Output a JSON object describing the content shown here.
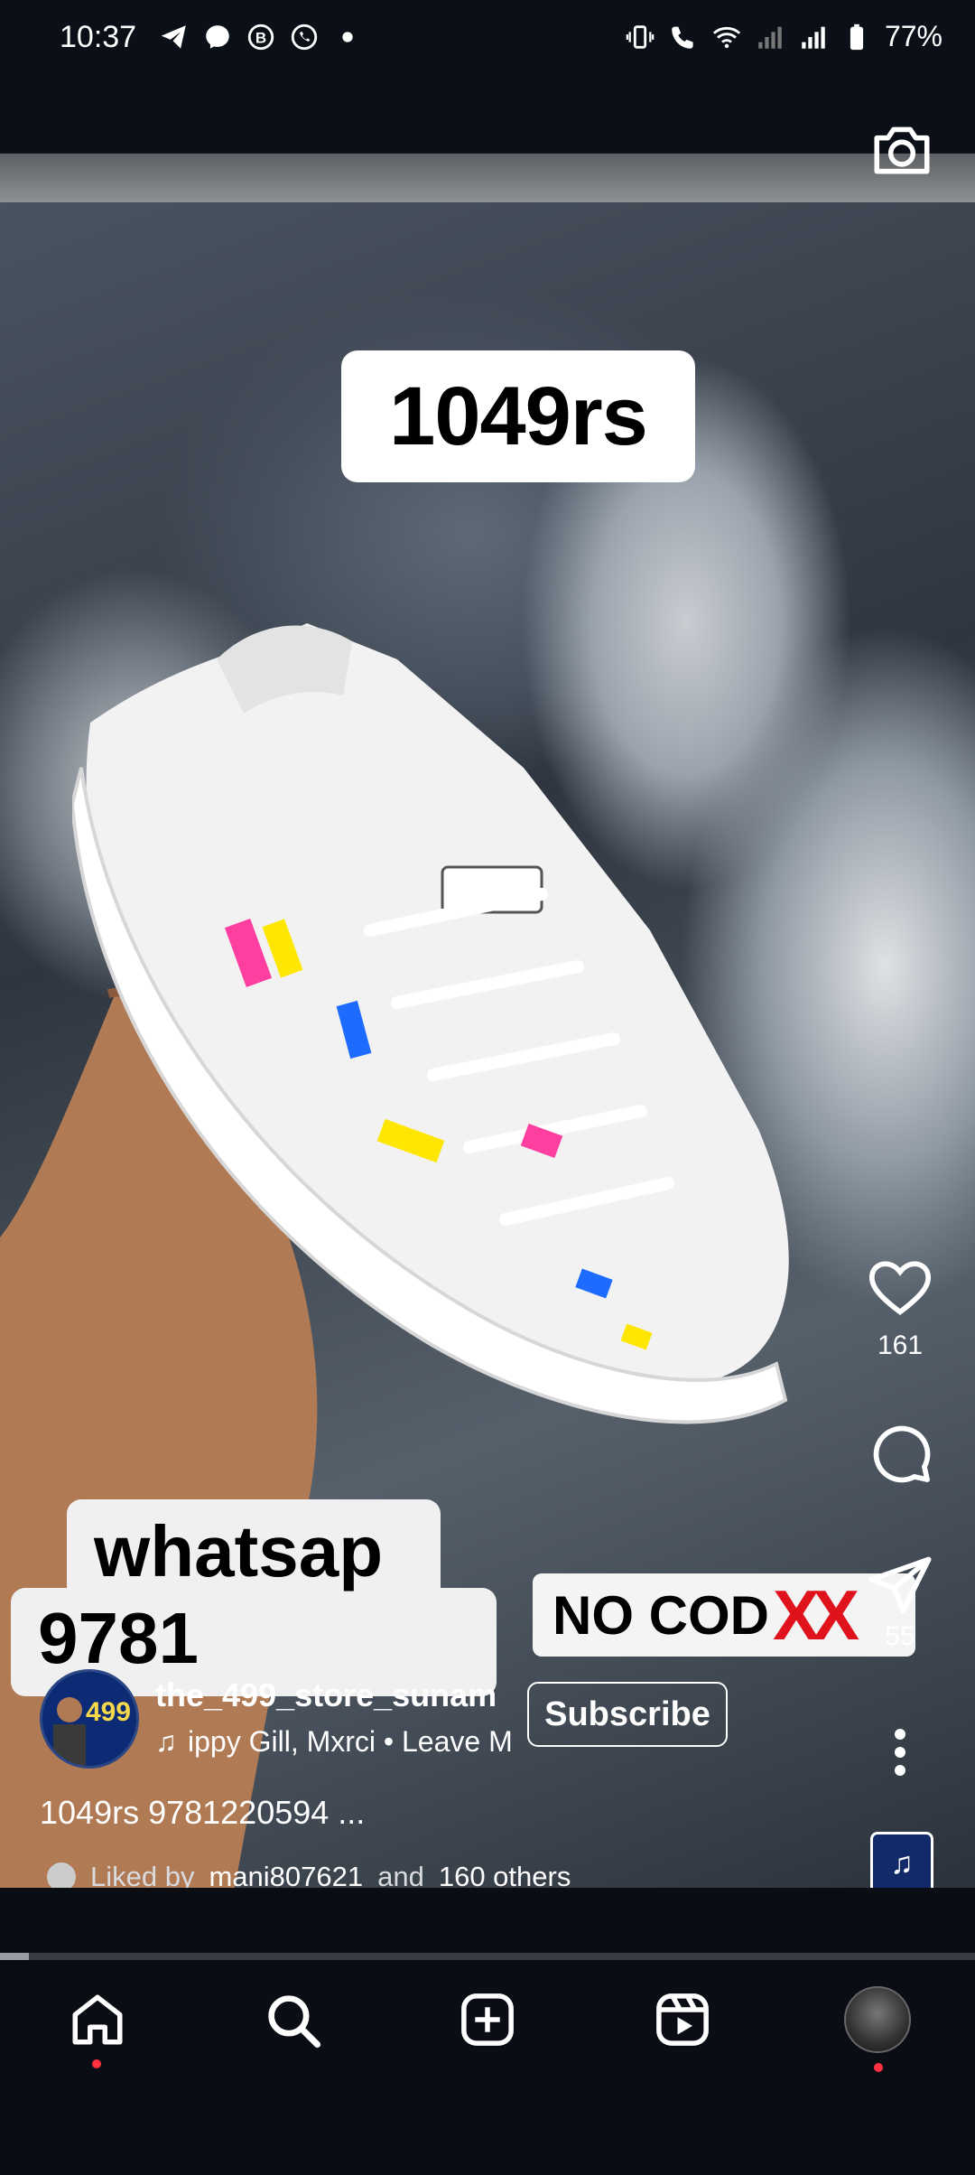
{
  "status_bar": {
    "time": "10:37",
    "battery": "77%",
    "left_icons": [
      "telegram-icon",
      "messenger-icon",
      "b-app-icon",
      "whatsapp-icon",
      "dot-icon"
    ],
    "right_icons": [
      "vibrate-icon",
      "wifi-call-icon",
      "wifi-icon",
      "signal-icon",
      "signal-icon",
      "battery-icon"
    ]
  },
  "reel": {
    "price_sticker": "1049rs",
    "whatsapp_line1": "whatsap",
    "whatsapp_line2": "9781",
    "nocod_text": "NO COD",
    "nocod_marks": "XX",
    "likes_count": "161",
    "shares_count": "55"
  },
  "author": {
    "avatar_label": "499",
    "username": "the_499_store_sunam",
    "audio": "ippy Gill, Mxrci • Leave M",
    "subscribe_label": "Subscribe"
  },
  "caption": "1049rs 9781220594 ...",
  "liked": {
    "prefix": "Liked by",
    "user": "mani807621",
    "middle": "and",
    "others": "160 others"
  },
  "progress": 0.03,
  "nav": {
    "items": [
      "home-icon",
      "search-icon",
      "create-icon",
      "reels-icon",
      "profile-avatar"
    ]
  },
  "colors": {
    "background": "#0a0d14",
    "notification_dot": "#ff3040",
    "no_cod_x": "#e0121b"
  }
}
